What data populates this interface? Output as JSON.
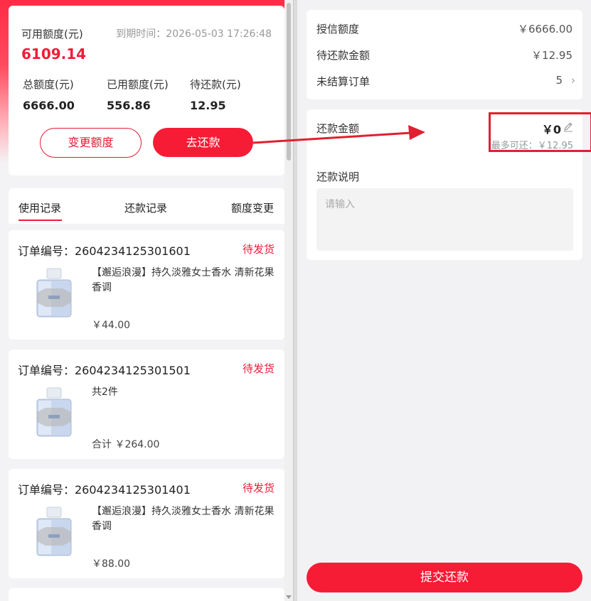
{
  "credit": {
    "available_label": "可用额度(元)",
    "available_value": "6109.14",
    "expire_text": "到期时间：2026-05-03 17:26:48",
    "stats": [
      {
        "label": "总额度(元)",
        "value": "6666.00"
      },
      {
        "label": "已用额度(元)",
        "value": "556.86"
      },
      {
        "label": "待还款(元)",
        "value": "12.95"
      }
    ],
    "change_button": "变更额度",
    "repay_button": "去还款"
  },
  "tabs": [
    {
      "label": "使用记录",
      "active": true
    },
    {
      "label": "还款记录",
      "active": false
    },
    {
      "label": "额度变更",
      "active": false
    }
  ],
  "orders": [
    {
      "order_no": "订单编号：2604234125301601",
      "status": "待发货",
      "title": "【邂逅浪漫】持久淡雅女士香水 清新花果香调",
      "price": "￥44.00"
    },
    {
      "order_no": "订单编号：2604234125301501",
      "status": "待发货",
      "title": "共2件",
      "price": "合计 ￥264.00"
    },
    {
      "order_no": "订单编号：2604234125301401",
      "status": "待发货",
      "title": "【邂逅浪漫】持久淡雅女士香水 清新花果香调",
      "price": "￥88.00"
    }
  ],
  "summary": {
    "rows": [
      {
        "label": "授信额度",
        "value": "￥6666.00"
      },
      {
        "label": "待还款金额",
        "value": "￥12.95"
      },
      {
        "label": "未结算订单",
        "value": "5"
      }
    ]
  },
  "repay": {
    "amount_label": "还款金额",
    "amount_value": "￥0",
    "max_text": "最多可还：￥12.95",
    "note_label": "还款说明",
    "note_placeholder": "请输入",
    "note_value": ""
  },
  "submit_button": "提交还款",
  "colors": {
    "accent": "#f61c36",
    "annotation": "#e02030"
  }
}
